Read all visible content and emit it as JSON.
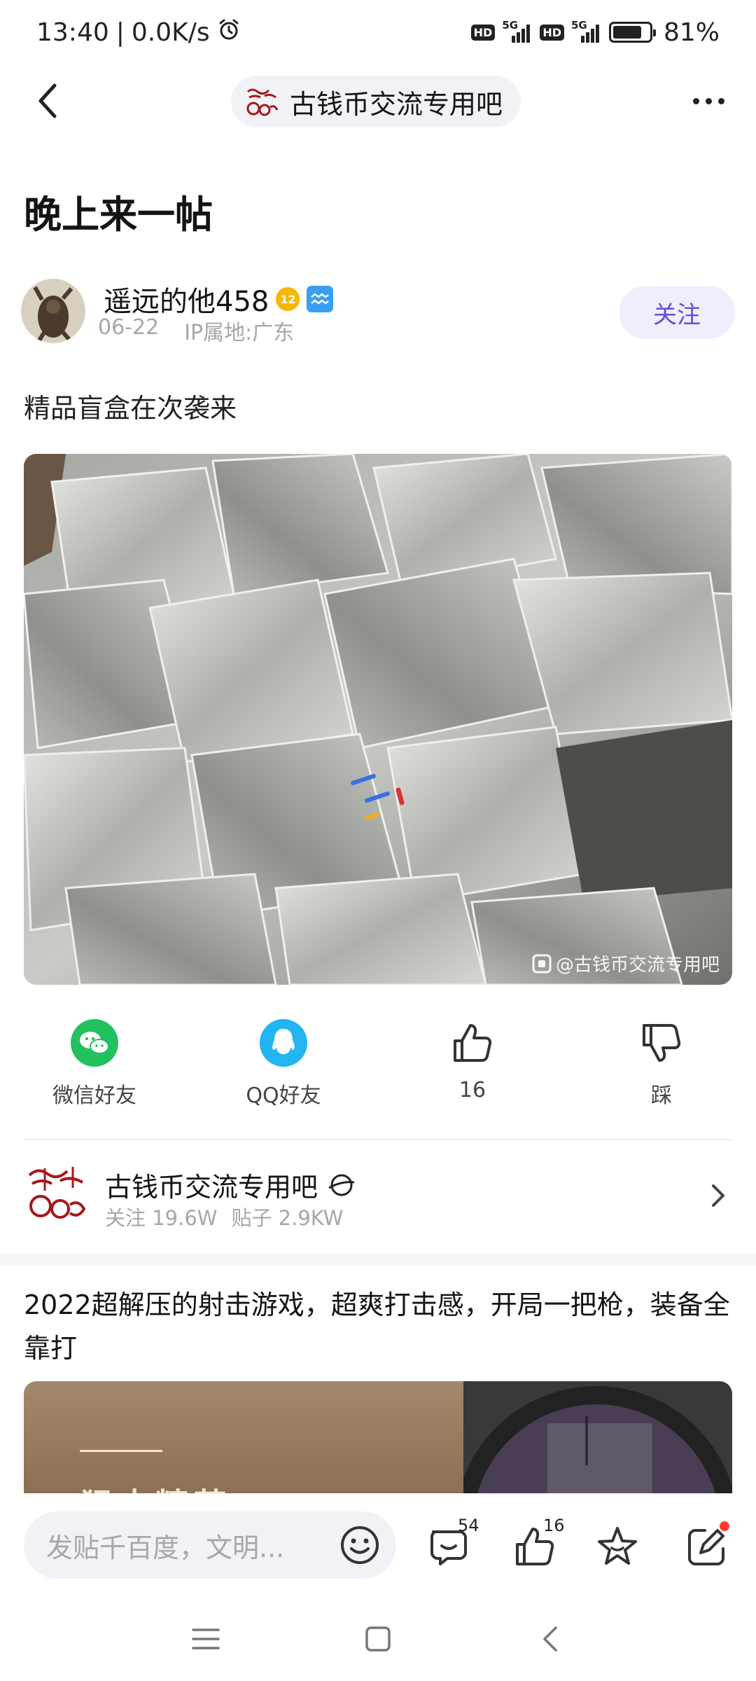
{
  "status_bar": {
    "time": "13:40",
    "speed": "0.0K/s",
    "network_1": "5G",
    "network_2": "5G",
    "hd_label": "HD",
    "battery_level": 0.81,
    "battery_text": "81%"
  },
  "header": {
    "forum_name": "古钱币交流专用吧"
  },
  "post": {
    "title": "晚上来一帖",
    "author": {
      "name": "遥远的他458",
      "level": "12",
      "date": "06-22",
      "ip": "IP属地:广东",
      "follow_label": "关注"
    },
    "body": "精品盲盒在次袭来",
    "image_watermark": "@古钱币交流专用吧"
  },
  "share": {
    "wechat_label": "微信好友",
    "qq_label": "QQ好友",
    "like_count": "16",
    "dislike_label": "踩"
  },
  "forum_card": {
    "name": "古钱币交流专用吧",
    "followers": "关注 19.6W",
    "posts": "贴子 2.9KW"
  },
  "ad": {
    "title": "2022超解压的射击游戏，超爽打击感，开局一把枪，装备全靠打",
    "banner_text": "狙击精英"
  },
  "bottom_bar": {
    "input_placeholder": "发贴千百度，文明...",
    "comment_count": "54",
    "like_count": "16"
  },
  "colors": {
    "accent": "#6150d6",
    "follow_bg": "#f1eefc",
    "wechat_green": "#22c15e",
    "qq_blue": "#23b4f2",
    "notification_red": "#ff3b30"
  }
}
